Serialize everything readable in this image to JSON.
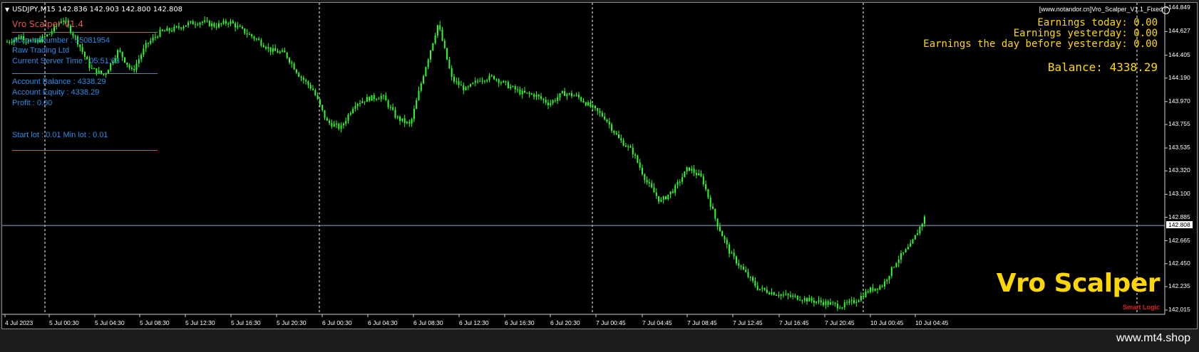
{
  "chart": {
    "symbol_header": "USDJPY,M15  142.836 142.903 142.800 142.808",
    "copyright": "[www.notandor.cn]Vro_Scalper_V1.1_Fixed",
    "bid_label": "142.808",
    "price_ticks": [
      "144.849",
      "144.627",
      "144.405",
      "144.190",
      "143.970",
      "143.755",
      "143.535",
      "143.320",
      "143.100",
      "142.885",
      "142.665",
      "142.450",
      "142.235",
      "142.015"
    ],
    "time_ticks": [
      "4 Jul 2023",
      "5 Jul 00:30",
      "5 Jul 04:30",
      "5 Jul 08:30",
      "5 Jul 12:30",
      "5 Jul 16:30",
      "5 Jul 20:30",
      "6 Jul 00:30",
      "6 Jul 04:30",
      "6 Jul 08:30",
      "6 Jul 12:30",
      "6 Jul 16:30",
      "6 Jul 20:30",
      "7 Jul 00:45",
      "7 Jul 04:45",
      "7 Jul 08:45",
      "7 Jul 12:45",
      "7 Jul 16:45",
      "7 Jul 20:45",
      "10 Jul 00:45",
      "10 Jul 04:45"
    ],
    "price_waypoints": [
      144.53,
      144.58,
      144.52,
      144.6,
      144.75,
      144.55,
      144.28,
      144.22,
      144.45,
      144.25,
      144.5,
      144.62,
      144.65,
      144.7,
      144.72,
      144.68,
      144.72,
      144.63,
      144.55,
      144.45,
      144.42,
      144.22,
      144.08,
      143.78,
      143.72,
      143.95,
      144.0,
      144.02,
      143.82,
      143.75,
      144.25,
      144.7,
      144.18,
      144.08,
      144.18,
      144.2,
      144.12,
      144.05,
      144.03,
      143.95,
      144.05,
      144.02,
      143.92,
      143.82,
      143.62,
      143.5,
      143.22,
      143.03,
      143.15,
      143.35,
      143.25,
      142.85,
      142.55,
      142.38,
      142.22,
      142.18,
      142.15,
      142.13,
      142.1,
      142.08,
      142.05,
      142.1,
      142.2,
      142.25,
      142.48,
      142.62,
      142.88
    ],
    "colors": {
      "candle": "#2cff2c",
      "grid": "#ffffff",
      "bid_line": "#8aa8c8"
    }
  },
  "panel": {
    "title": "Vro Scalper V1.4",
    "account_number": "AccountNumber : 55081954",
    "server": "Raw Trading Ltd",
    "server_time": "Current Server Time : 05:51:03",
    "balance": "Account Balance : 4338.29",
    "equity": "Account Equity : 4338.29",
    "profit": "Profit : 0.00",
    "lots": "Start lot : 0.01  Min lot : 0.01"
  },
  "earnings": {
    "today": "Earnings today: 0.00",
    "yesterday": "Earnings yesterday: 0.00",
    "before": "Earnings the day before yesterday: 0.00",
    "balance": "Balance: 4338.29"
  },
  "brand": {
    "title": "Vro Scalper",
    "subtitle": "Smart Logic"
  },
  "footer": {
    "url": "www.mt4.shop"
  }
}
